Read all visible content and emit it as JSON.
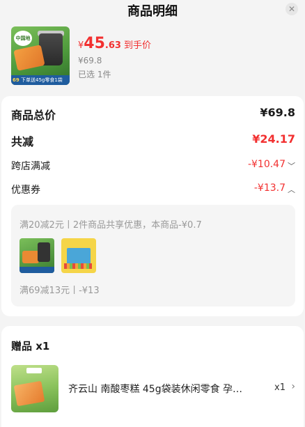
{
  "header": {
    "title": "商品明细",
    "close_icon": "close-icon"
  },
  "product": {
    "image_banner_num": "69",
    "image_banner_text": "下单送45g零食1袋",
    "image_stamp_text": "中国地标",
    "price_currency": "¥",
    "price_int": "45",
    "price_dec": ".63",
    "price_tag": "到手价",
    "original_price": "¥69.8",
    "selected_text": "已选 1件"
  },
  "summary": {
    "total_label": "商品总价",
    "total_value": "¥69.8",
    "reduce_label": "共减",
    "reduce_value": "¥24.17",
    "cross_label": "跨店满减",
    "cross_value": "-¥10.47",
    "coupon_label": "优惠券",
    "coupon_value": "-¥13.7"
  },
  "coupon_detail": {
    "rule1": "满20减2元丨2件商品共享优惠，本商品-¥0.7",
    "rule2": "满69减13元丨-¥13"
  },
  "gift": {
    "title": "赠品 x1",
    "name": "齐云山 南酸枣糕 45g袋装休闲零食 孕…",
    "qty": "x1"
  },
  "colors": {
    "accent_red": "#f23030",
    "card_bg": "#ffffff",
    "page_bg": "#f4f4f4",
    "sub_text": "#999999"
  }
}
